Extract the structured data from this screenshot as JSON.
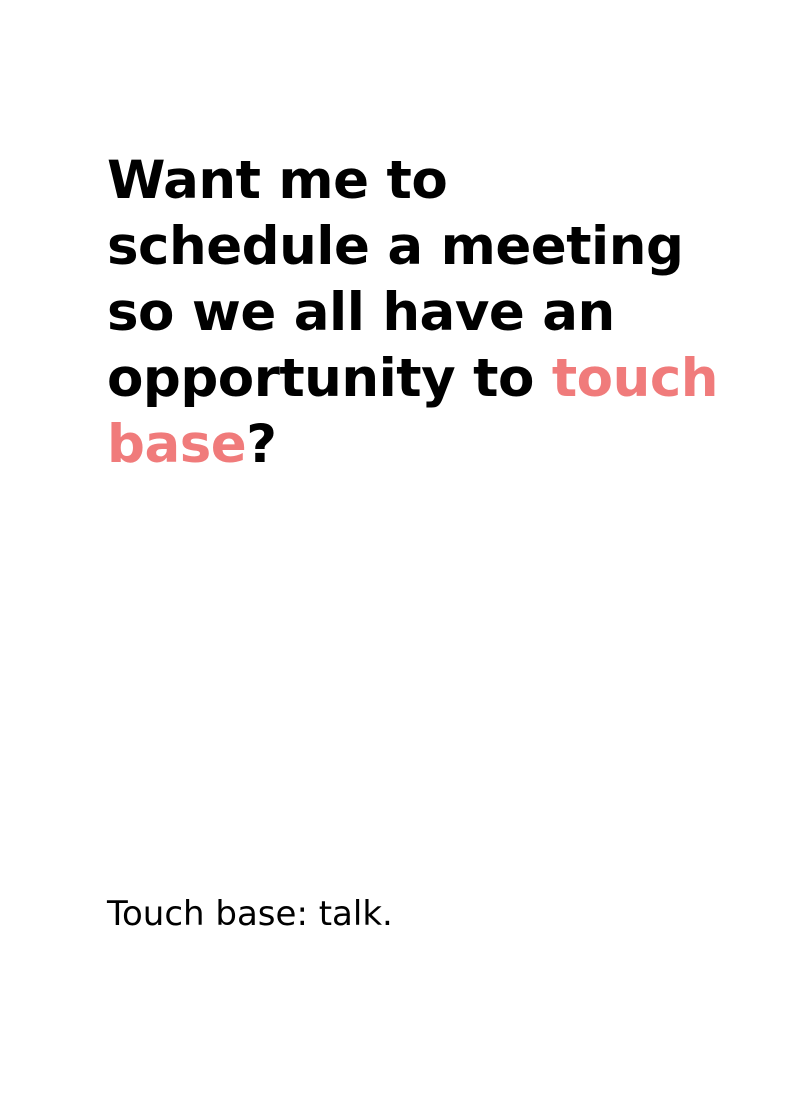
{
  "headline": {
    "line1": "Want me to",
    "line2": "schedule a meeting",
    "line3": "so we all have an",
    "line4_prefix": "opportunity to ",
    "line4_highlight": "touch",
    "line5_highlight": "base",
    "line5_suffix": "?"
  },
  "definition": "Touch base: talk.",
  "colors": {
    "text": "#000000",
    "highlight": "#f07b7b",
    "background": "#ffffff"
  }
}
